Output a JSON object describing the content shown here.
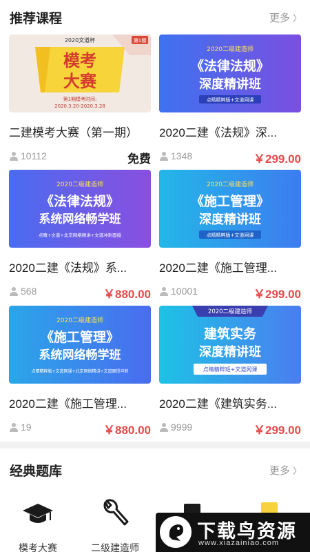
{
  "recommended": {
    "title": "推荐课程",
    "more_label": "更多",
    "courses": [
      {
        "thumb": {
          "top_text": "2020文道杯",
          "main_line1": "模考",
          "main_line2": "大赛",
          "sub1": "第1期模考时间:",
          "sub2": "2020.3.20-2020.3.28",
          "badge": "第1期"
        },
        "title": "二建模考大赛（第一期）",
        "count": "10112",
        "price": "免费"
      },
      {
        "thumb": {
          "top_text": "2020二级建造师",
          "main_line1": "《法律法规》",
          "main_line2": "深度精讲班",
          "footer": "点睛精粹版+文道网课"
        },
        "title": "2020二建《法规》深...",
        "count": "1348",
        "price": "￥299.00"
      },
      {
        "thumb": {
          "top_text": "2020二级建造师",
          "main_line1": "《法律法规》",
          "main_line2": "系统网络畅学班",
          "footer": "点睛+文道+北京网络精讲+文道冲刺面授"
        },
        "title": "2020二建《法规》系...",
        "count": "568",
        "price": "￥880.00"
      },
      {
        "thumb": {
          "top_text": "2020二级建造师",
          "main_line1": "《施工管理》",
          "main_line2": "深度精讲班",
          "footer": "点睛精粹版+文道网课"
        },
        "title": "2020二建《施工管理...",
        "count": "10001",
        "price": "￥299.00"
      },
      {
        "thumb": {
          "top_text": "2020二级建造师",
          "main_line1": "《施工管理》",
          "main_line2": "系统网络畅学班",
          "footer": "点睛精粹版+文道网课+北京网络精讲+文道面授冲刺"
        },
        "title": "2020二建《施工管理...",
        "count": "19",
        "price": "￥880.00"
      },
      {
        "thumb": {
          "top_text": "2020二级建造师",
          "main_line1": "建筑实务",
          "main_line2": "深度精讲班",
          "footer": "点睛精粹班+文道网课"
        },
        "title": "2020二建《建筑实务...",
        "count": "9999",
        "price": "￥299.00"
      }
    ]
  },
  "question_bank": {
    "title": "经典题库",
    "more_label": "更多",
    "categories": [
      {
        "label": "模考大赛",
        "icon": "graduation-cap-icon"
      },
      {
        "label": "二级建造师",
        "icon": "wrench-icon"
      },
      {
        "label": "",
        "icon": "book-icon"
      },
      {
        "label": "",
        "icon": "document-icon"
      }
    ]
  },
  "watermark": {
    "title": "下载鸟资源",
    "url": "www.xiazainiao.com"
  },
  "colors": {
    "price_red": "#e74a4a",
    "accent_blue": "#3f6fe8",
    "gold": "#f7d23e"
  }
}
